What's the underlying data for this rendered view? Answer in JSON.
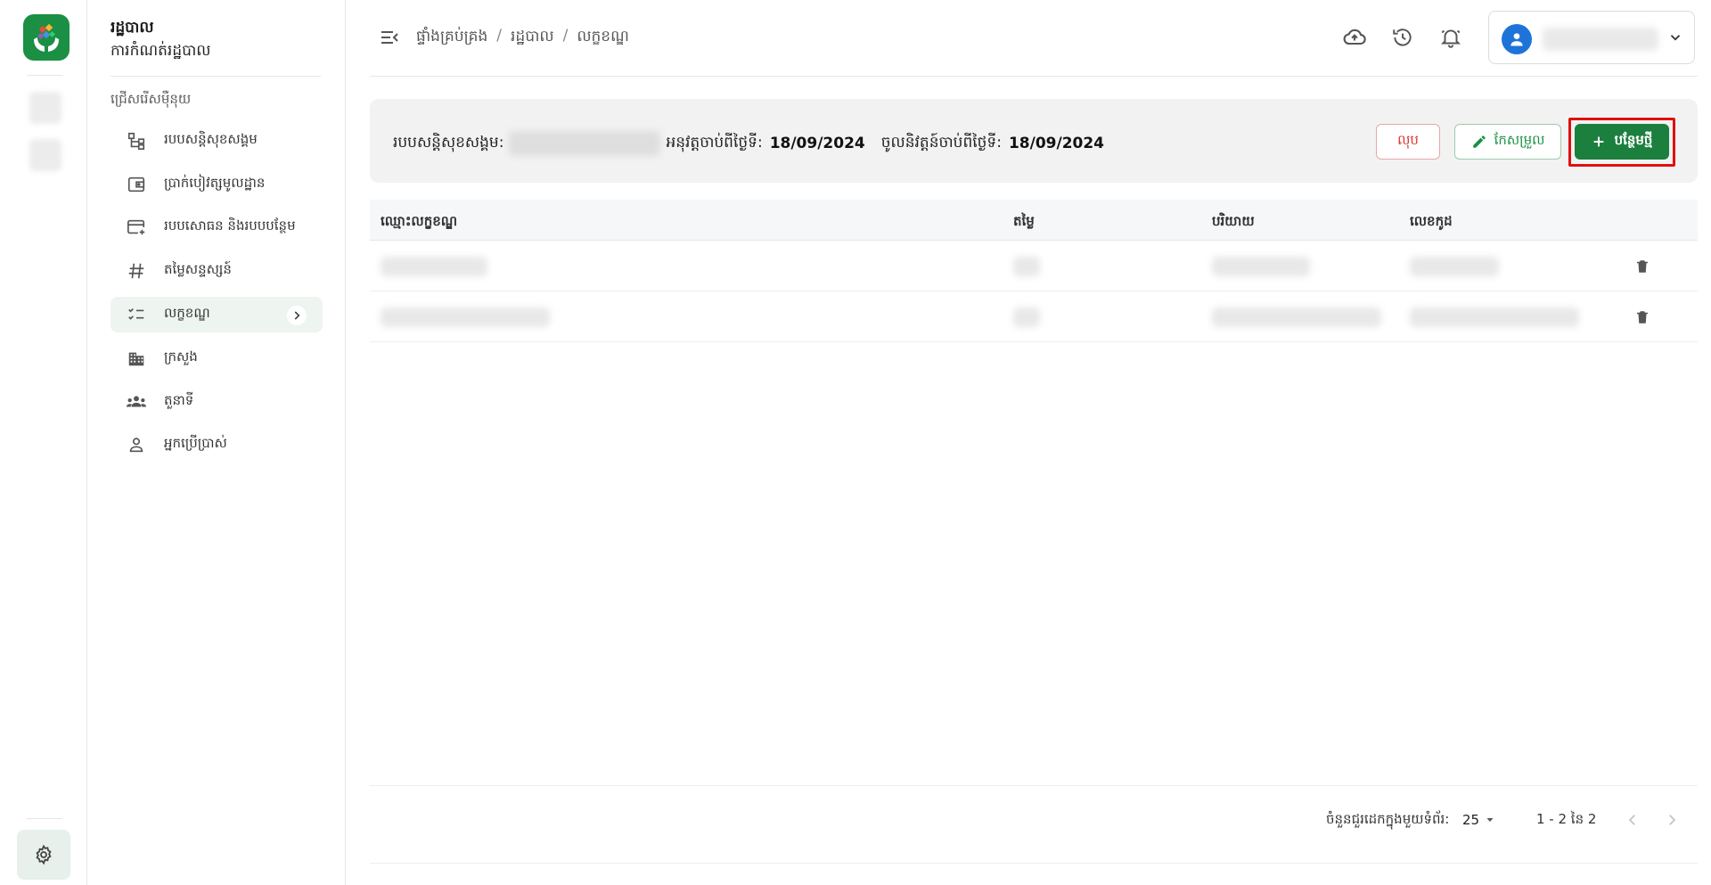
{
  "app": {
    "title": "រដ្ឋបាល",
    "subtitle": "ការកំណត់រដ្ឋបាល",
    "brand_color": "#1b8f44"
  },
  "sidebar": {
    "section_label": "ជ្រើសរើសម៉ឺនុយ",
    "items": [
      {
        "label": "របបសន្តិសុខសង្គម",
        "icon": "hierarchy-icon"
      },
      {
        "label": "ប្រាក់បៀវត្សមូលដ្ឋាន",
        "icon": "wallet-icon"
      },
      {
        "label": "របបសោធន និងរបបបន្ថែម",
        "icon": "card-add-icon"
      },
      {
        "label": "តម្លៃសន្ទស្សន៍",
        "icon": "hash-icon"
      },
      {
        "label": "លក្ខខណ្ឌ",
        "icon": "checklist-icon",
        "active": true
      },
      {
        "label": "ក្រសួង",
        "icon": "building-icon"
      },
      {
        "label": "តួនាទី",
        "icon": "group-icon"
      },
      {
        "label": "អ្នកប្រើប្រាស់",
        "icon": "person-icon"
      }
    ]
  },
  "breadcrumb": [
    "ផ្ទាំងគ្រប់គ្រង",
    "រដ្ឋបាល",
    "លក្ខខណ្ឌ"
  ],
  "infobar": {
    "scheme_label": "របបសន្តិសុខសង្គម:",
    "approved_label": "អនុវត្តចាប់ពីថ្ងៃទី:",
    "approved_date": "18/09/2024",
    "effective_label": "ចូលនិវត្តន៍ចាប់ពីថ្ងៃទី:",
    "effective_date": "18/09/2024",
    "delete_label": "លុប",
    "edit_label": "កែសម្រួល",
    "add_label": "បន្ថែមថ្មី"
  },
  "table": {
    "columns": [
      "ឈ្មោះលក្ខខណ្ឌ",
      "តម្លៃ",
      "បរិយាយ",
      "លេខកូដ"
    ],
    "rows": 2
  },
  "pagination": {
    "rows_per_page_label": "ចំនួនជួរដេកក្នុងមួយទំព័រ:",
    "rows_per_page": "25",
    "range": "1 - 2 នៃ 2"
  }
}
